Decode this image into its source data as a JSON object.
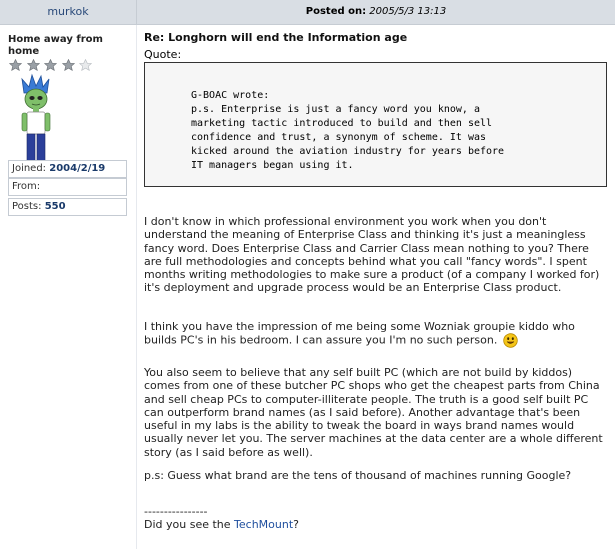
{
  "header": {
    "author": "murkok",
    "posted_label": "Posted on:",
    "posted_value": "2005/5/3 13:13"
  },
  "sidebar": {
    "rank_title": "Home away from home",
    "stars": {
      "filled": 4,
      "total": 5
    },
    "joined_label": "Joined:",
    "joined_value": "2004/2/19",
    "from_label": "From:",
    "from_value": "",
    "posts_label": "Posts:",
    "posts_value": "550"
  },
  "post": {
    "title": "Re: Longhorn will end the Information age",
    "quote_label": "Quote:",
    "quote_lines": [
      "G-BOAC wrote:",
      "p.s. Enterprise is just a fancy word you know, a",
      "marketing tactic introduced to build and then sell",
      "confidence and trust, a synonym of scheme. It was",
      "kicked around the aviation industry for years before",
      "IT managers began using it."
    ],
    "paragraph1": "I don't know in which professional environment you work when you don't understand the meaning of Enterprise Class and thinking it's just a meaningless fancy word. Does Enterprise Class and Carrier Class mean nothing to you? There are full methodologies and concepts behind what you call \"fancy words\". I spent months writing methodologies to make sure a product (of a company I worked for) it's deployment and upgrade process would be an Enterprise Class product.",
    "paragraph2": "I think you have the impression of me being some Wozniak groupie kiddo who builds PC's in his bedroom. I can assure you I'm no such person.",
    "paragraph3": "You also seem to believe that any self built PC (which are not build by kiddos) comes from one of these butcher PC shops who get the cheapest parts from China and sell cheap PCs to computer-illiterate people. The truth is a good self built PC can outperform brand names (as I said before). Another advantage that's been useful in my labs is the ability to tweak the board in ways brand names would usually never let you. The server machines at the data center are a whole different story (as I said before as well).",
    "paragraph4": "p.s: Guess what brand are the tens of thousand of machines running Google?",
    "signature_rule": "----------------",
    "signature_prefix": "Did you see the ",
    "signature_link": "TechMount",
    "signature_suffix": "?"
  },
  "colors": {
    "header_bg": "#d9dee4",
    "link": "#1e4e9e",
    "quote_bg": "#f6f6f6"
  }
}
